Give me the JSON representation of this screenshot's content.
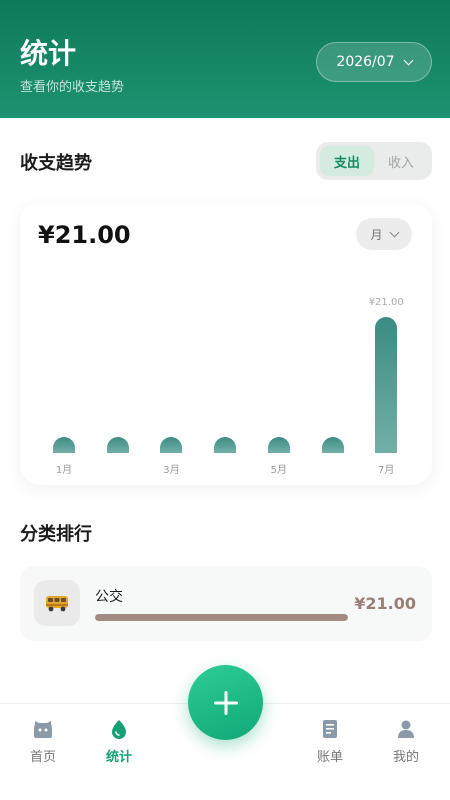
{
  "header": {
    "title": "统计",
    "subtitle": "查看你的收支趋势",
    "month_selector": "2026/07"
  },
  "trend": {
    "section_title": "收支趋势",
    "toggle": {
      "expense": "支出",
      "income": "收入",
      "selected": "expense"
    },
    "total": "¥21.00",
    "period": "月"
  },
  "chart_data": {
    "type": "bar",
    "categories": [
      "1月",
      "2月",
      "3月",
      "4月",
      "5月",
      "6月",
      "7月"
    ],
    "x_tick_labels": [
      "1月",
      "",
      "3月",
      "",
      "5月",
      "",
      "7月"
    ],
    "values": [
      0,
      0,
      0,
      0,
      0,
      0,
      21.0
    ],
    "data_labels": [
      "",
      "",
      "",
      "",
      "",
      "",
      "¥21.00"
    ],
    "max": 21.0,
    "bar_color_top": "#3b8b84",
    "bar_color_bottom": "#73b0a7"
  },
  "ranking": {
    "section_title": "分类排行",
    "items": [
      {
        "name": "公交",
        "amount": "¥21.00",
        "share": 1.0,
        "icon": "bus-icon"
      }
    ]
  },
  "tabbar": {
    "items": [
      {
        "label": "首页",
        "icon": "home-icon",
        "active": false
      },
      {
        "label": "统计",
        "icon": "stats-drop-icon",
        "active": true
      },
      {
        "label": "账单",
        "icon": "bill-icon",
        "active": false
      },
      {
        "label": "我的",
        "icon": "profile-icon",
        "active": false
      }
    ],
    "add_icon": "plus-icon"
  },
  "colors": {
    "brand": "#13906a",
    "accent": "#16a074",
    "amount": "#9a7f76"
  }
}
